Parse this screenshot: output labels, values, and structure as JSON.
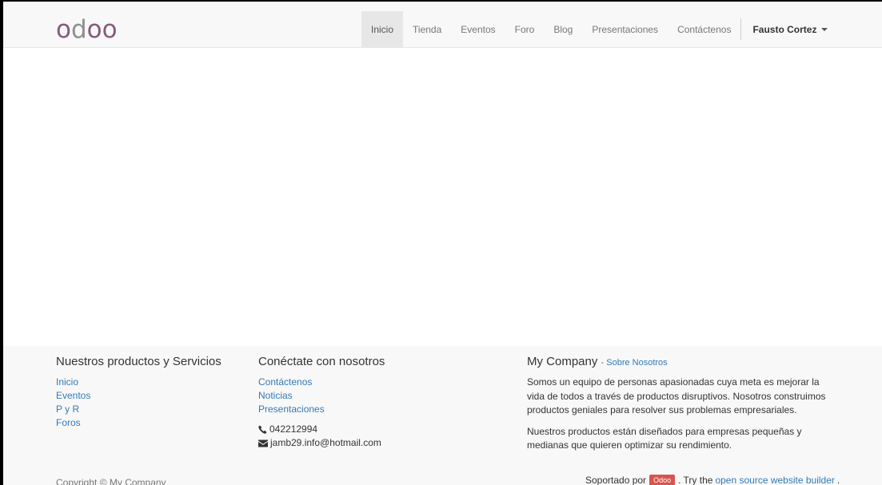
{
  "brand": {
    "logo_text": "odoo",
    "logo_color": "#875a7b"
  },
  "nav": {
    "items": [
      {
        "label": "Inicio",
        "active": true
      },
      {
        "label": "Tienda"
      },
      {
        "label": "Eventos"
      },
      {
        "label": "Foro"
      },
      {
        "label": "Blog"
      },
      {
        "label": "Presentaciones"
      },
      {
        "label": "Contáctenos"
      }
    ],
    "user": "Fausto Cortez",
    "user_icon": "caret-down-icon"
  },
  "footer": {
    "col1": {
      "title": "Nuestros productos y Servicios",
      "links": [
        "Inicio",
        "Eventos",
        "P y R",
        "Foros"
      ]
    },
    "col2": {
      "title": "Conéctate con nosotros",
      "links": [
        "Contáctenos",
        "Noticias",
        "Presentaciones"
      ],
      "phone": "042212994",
      "email": "jamb29.info@hotmail.com"
    },
    "col3": {
      "title": "My Company",
      "subtitle": "- Sobre Nosotros",
      "paragraphs": [
        "Somos un equipo de personas apasionadas cuya meta es mejorar la vida de todos a través de productos disruptivos. Nosotros construimos productos geniales para resolver sus problemas empresariales.",
        "Nuestros productos están diseñados para empresas pequeñas y medianas que quieren optimizar su rendimiento."
      ]
    },
    "copyright": "Copyright © My Company",
    "powered": {
      "prefix": "Soportado por",
      "badge": "Odoo",
      "middle": ". Try the",
      "link": "open source website builder",
      "suffix": "."
    }
  },
  "colors": {
    "link": "#337ab7",
    "navbar_bg": "#f8f8f8",
    "badge": "#d9534f"
  }
}
